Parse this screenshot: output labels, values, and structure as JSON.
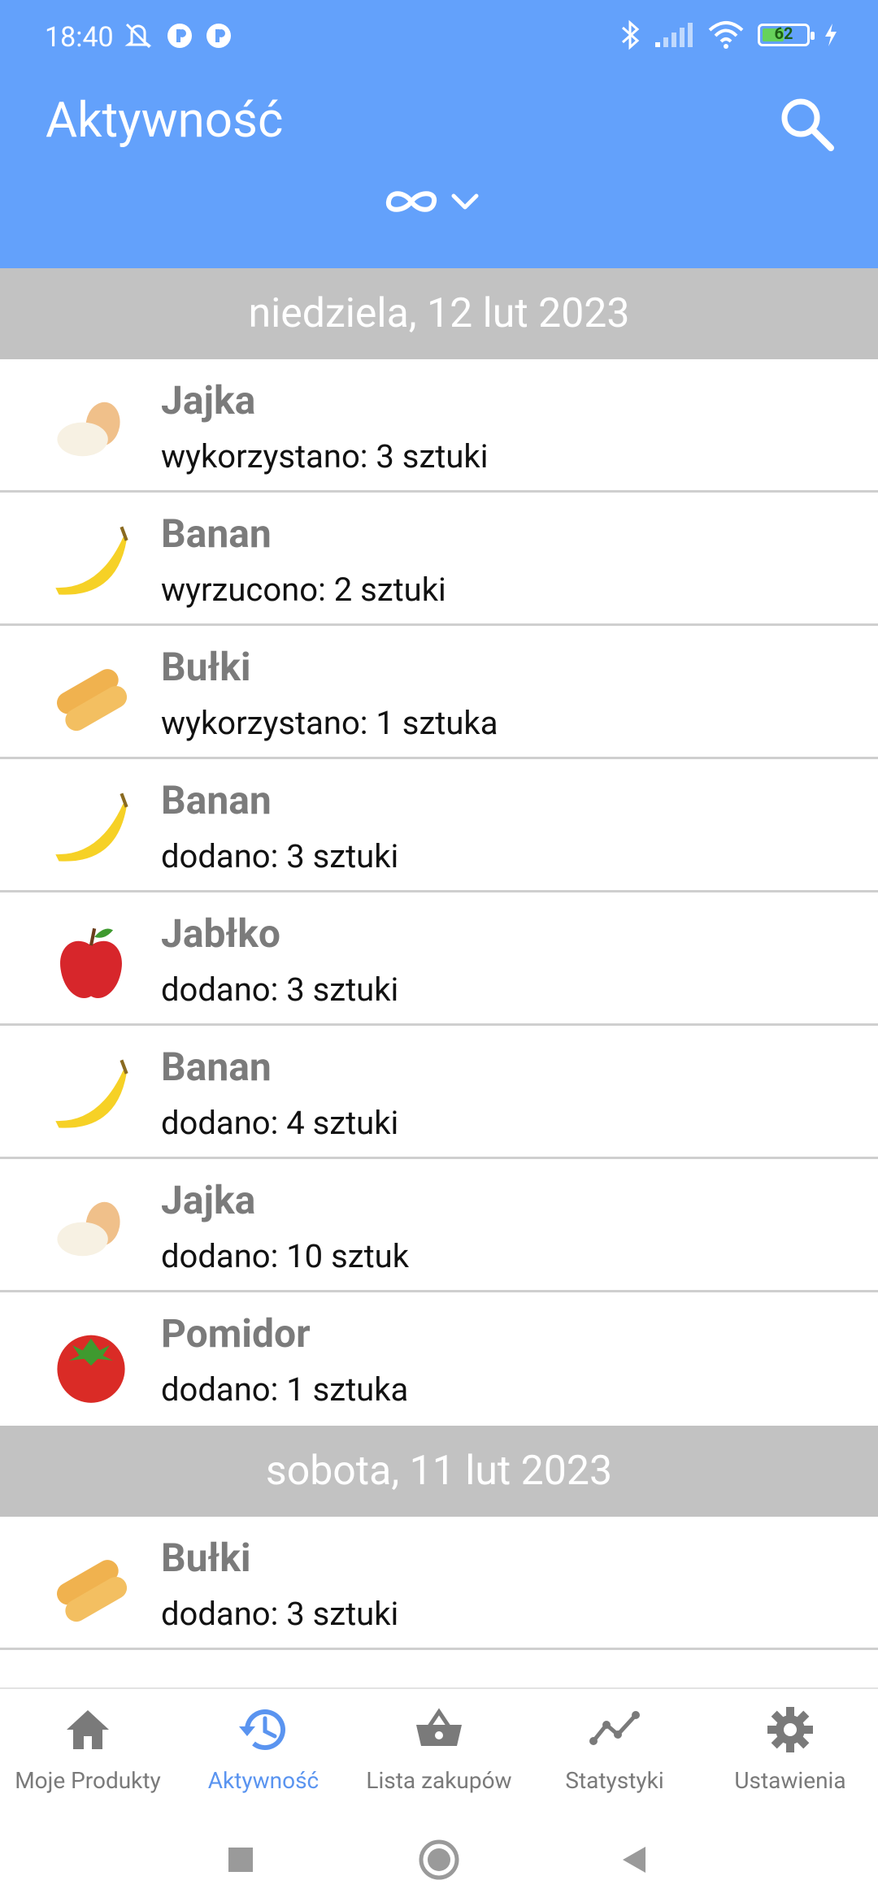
{
  "status_bar": {
    "time": "18:40",
    "battery": "62"
  },
  "header": {
    "title": "Aktywność"
  },
  "groups": [
    {
      "date": "niedziela, 12 lut 2023",
      "items": [
        {
          "name": "Jajka",
          "desc": "wykorzystano: 3 sztuki",
          "icon": "egg-icon"
        },
        {
          "name": "Banan",
          "desc": "wyrzucono: 2 sztuki",
          "icon": "banana-icon"
        },
        {
          "name": "Bułki",
          "desc": "wykorzystano: 1 sztuka",
          "icon": "bread-icon"
        },
        {
          "name": "Banan",
          "desc": "dodano: 3 sztuki",
          "icon": "banana-icon"
        },
        {
          "name": "Jabłko",
          "desc": "dodano: 3 sztuki",
          "icon": "apple-icon"
        },
        {
          "name": "Banan",
          "desc": "dodano: 4 sztuki",
          "icon": "banana-icon"
        },
        {
          "name": "Jajka",
          "desc": "dodano: 10 sztuk",
          "icon": "egg-icon"
        },
        {
          "name": "Pomidor",
          "desc": "dodano: 1 sztuka",
          "icon": "tomato-icon"
        }
      ]
    },
    {
      "date": "sobota, 11 lut 2023",
      "items": [
        {
          "name": "Bułki",
          "desc": "dodano: 3 sztuki",
          "icon": "bread-icon"
        }
      ]
    }
  ],
  "nav": [
    {
      "label": "Moje Produkty",
      "icon": "home-icon"
    },
    {
      "label": "Aktywność",
      "icon": "history-icon",
      "active": true
    },
    {
      "label": "Lista zakupów",
      "icon": "basket-icon"
    },
    {
      "label": "Statystyki",
      "icon": "chart-icon"
    },
    {
      "label": "Ustawienia",
      "icon": "gear-icon"
    }
  ],
  "colors": {
    "header": "#63a1fb",
    "separator": "#c2c2c2",
    "active": "#5a94f0"
  }
}
